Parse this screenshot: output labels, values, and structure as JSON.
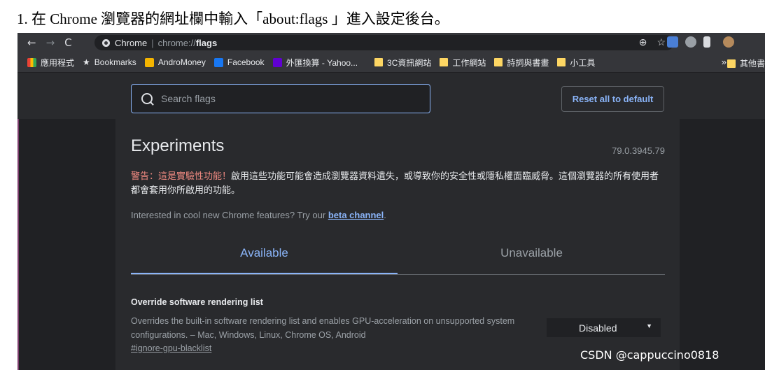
{
  "caption": "1. 在 Chrome 瀏覽器的網址欄中輸入「about:flags 」進入設定後台。",
  "browser": {
    "omnibox": {
      "site_label": "Chrome",
      "url_prefix": "chrome://",
      "url_bold": "flags"
    },
    "bookmarks": [
      {
        "label": "應用程式",
        "icon": "apps-grid-icon"
      },
      {
        "label": "Bookmarks",
        "icon": "star-icon"
      },
      {
        "label": "AndroMoney",
        "icon": "andromoney-icon"
      },
      {
        "label": "Facebook",
        "icon": "facebook-icon"
      },
      {
        "label": "外匯換算 - Yahoo...",
        "icon": "yahoo-icon"
      },
      {
        "label": "3C資訊網站",
        "icon": "folder-icon"
      },
      {
        "label": "工作網站",
        "icon": "folder-icon"
      },
      {
        "label": "詩詞與書畫",
        "icon": "folder-icon"
      },
      {
        "label": "小工具",
        "icon": "folder-icon"
      }
    ],
    "bookmarks_more": "»",
    "bookmarks_other": "其他書",
    "colors": {
      "accent": "#8ab4f8",
      "warning": "#f28b82",
      "background": "#202124",
      "panel": "#292a2d"
    }
  },
  "flags_page": {
    "search_placeholder": "Search flags",
    "reset_label": "Reset all to default",
    "title": "Experiments",
    "version": "79.0.3945.79",
    "warning_prefix": "警告：這是實驗性功能！",
    "warning_text": "啟用這些功能可能會造成瀏覽器資料遺失，或導致你的安全性或隱私權面臨威脅。這個瀏覽器的所有使用者都會套用你所啟用的功能。",
    "interest_text": "Interested in cool new Chrome features? Try our ",
    "interest_link": "beta channel",
    "interest_end": ".",
    "tabs": [
      {
        "label": "Available",
        "active": true
      },
      {
        "label": "Unavailable",
        "active": false
      }
    ],
    "flag": {
      "title": "Override software rendering list",
      "description": "Overrides the built-in software rendering list and enables GPU-acceleration on unsupported system configurations. – Mac, Windows, Linux, Chrome OS, Android",
      "link": "#ignore-gpu-blacklist",
      "value": "Disabled"
    }
  },
  "watermark": "CSDN @cappuccino0818"
}
